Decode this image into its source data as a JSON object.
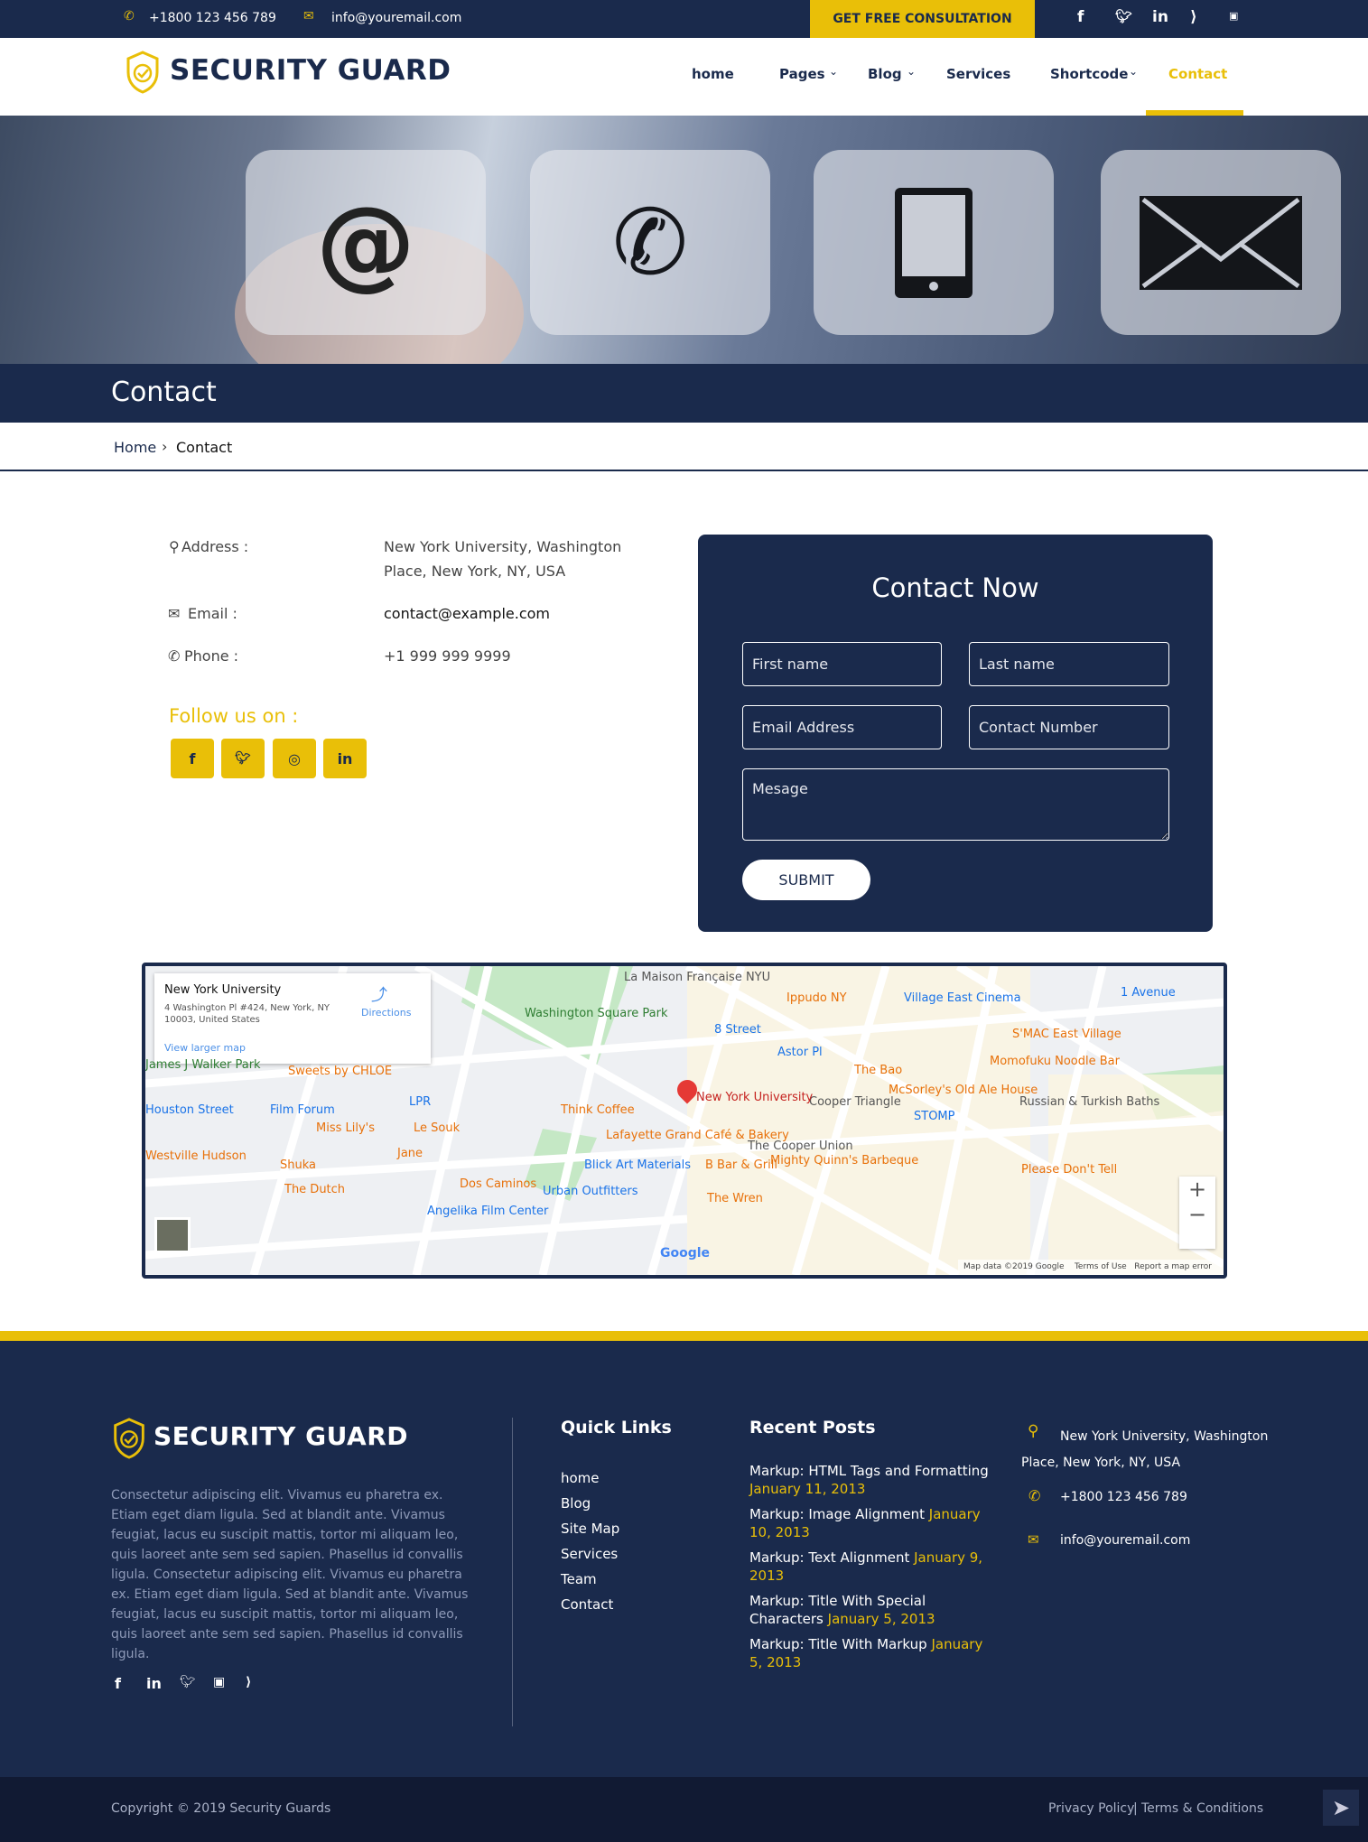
{
  "topbar": {
    "phone": "+1800 123 456 789",
    "email": "info@youremail.com",
    "consult": "GET FREE CONSULTATION",
    "social": [
      "facebook",
      "twitter",
      "linkedin",
      "rss",
      "youtube"
    ]
  },
  "brand": {
    "name": "SECURITY GUARD"
  },
  "nav": {
    "items": [
      {
        "label": "home"
      },
      {
        "label": "Pages"
      },
      {
        "label": "Blog"
      },
      {
        "label": "Services"
      },
      {
        "label": "Shortcode"
      },
      {
        "label": "Contact"
      }
    ],
    "active": "Contact"
  },
  "hero": {
    "icons": [
      "at-icon",
      "phone-icon",
      "tablet-icon",
      "envelope-icon"
    ]
  },
  "page": {
    "title": "Contact"
  },
  "breadcrumb": {
    "home": "Home",
    "sep": "›",
    "current": "Contact"
  },
  "info": {
    "address_label": "Address :",
    "address": "New York University, Washington Place, New York, NY, USA",
    "email_label": "Email :",
    "email": "contact@example.com",
    "phone_label": "Phone :",
    "phone": "+1 999 999 9999",
    "follow": "Follow us on :"
  },
  "form": {
    "title": "Contact Now",
    "first": "First name",
    "last": "Last name",
    "email": "Email Address",
    "number": "Contact Number",
    "message": "Mesage",
    "submit": "SUBMIT"
  },
  "map": {
    "place": "New York University",
    "address": "4 Washington Pl #424, New York, NY 10003, United States",
    "directions": "Directions",
    "larger": "View larger map",
    "labels": [
      "La Maison Française NYU",
      "Washington Square Park",
      "8 Street",
      "Ippudo NY",
      "Village East Cinema",
      "1 Avenue",
      "Astor Pl",
      "S'MAC East Village",
      "Momofuku Noodle Bar",
      "The Bao",
      "McSorley's Old Ale House",
      "Russian & Turkish Baths",
      "Cooper Triangle",
      "STOMP",
      "The Cooper Union",
      "Mighty Quinn's Barbeque",
      "Please Don't Tell",
      "James J Walker Park",
      "Sweets by CHLOE",
      "Film Forum",
      "LPR",
      "Think Coffee",
      "Miss Lily's",
      "Le Souk",
      "Jane",
      "Lafayette Grand Café & Bakery",
      "Houston Street",
      "Westville Hudson",
      "Shuka",
      "The Dutch",
      "Dos Caminos",
      "Blick Art Materials",
      "B Bar & Grill",
      "Urban Outfitters",
      "The Wren",
      "Angelika Film Center"
    ],
    "footer": "Map data ©2019 Google",
    "terms": "Terms of Use",
    "report": "Report a map error",
    "google": "Google"
  },
  "footer": {
    "about": "Consectetur adipiscing elit. Vivamus eu pharetra ex. Etiam eget diam ligula. Sed at blandit ante. Vivamus feugiat, lacus eu suscipit mattis, tortor mi aliquam leo, quis laoreet ante sem sed sapien. Phasellus id convallis ligula. Consectetur adipiscing elit. Vivamus eu pharetra ex. Etiam eget diam ligula. Sed at blandit ante. Vivamus feugiat, lacus eu suscipit mattis, tortor mi aliquam leo, quis laoreet ante sem sed sapien. Phasellus id convallis ligula.",
    "quick_title": "Quick Links",
    "quick": [
      "home",
      "Blog",
      "Site Map",
      "Services",
      "Team",
      "Contact"
    ],
    "posts_title": "Recent Posts",
    "posts": [
      {
        "title": "Markup: HTML Tags and Formatting",
        "date": "January 11, 2013"
      },
      {
        "title": "Markup: Image Alignment",
        "date": "January 10, 2013"
      },
      {
        "title": "Markup: Text Alignment",
        "date": "January 9, 2013"
      },
      {
        "title": "Markup: Title With Special Characters",
        "date": "January 5, 2013"
      },
      {
        "title": "Markup: Title With Markup",
        "date": "January 5, 2013"
      }
    ],
    "address": "New York University, Washington Place, New York, NY, USA",
    "phone": "+1800 123 456 789",
    "email": "info@youremail.com"
  },
  "bottom": {
    "copyright": "Copyright © 2019 Security Guards",
    "privacy": "Privacy Policy",
    "sep": "|",
    "terms": "Terms & Conditions"
  },
  "colors": {
    "navy": "#1a2a4c",
    "yellow": "#e9bf08"
  }
}
